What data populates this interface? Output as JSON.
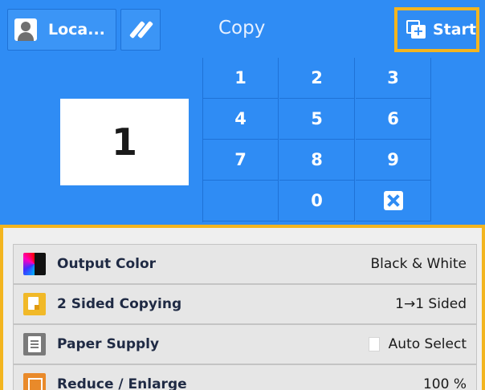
{
  "header": {
    "user_label": "Loca...",
    "title": "Copy",
    "start_label": "Start",
    "accent_color": "#2f8cf4",
    "highlight_color": "#f3b51f"
  },
  "quantity": {
    "value": "1"
  },
  "keypad": {
    "keys": [
      "1",
      "2",
      "3",
      "4",
      "5",
      "6",
      "7",
      "8",
      "9",
      "0"
    ],
    "clear_icon": "clear-icon"
  },
  "features": [
    {
      "name": "Output Color",
      "value": "Black & White",
      "icon": "color-mode-icon"
    },
    {
      "name": "2 Sided Copying",
      "value": "1→1 Sided",
      "icon": "duplex-icon"
    },
    {
      "name": "Paper Supply",
      "value": "Auto Select",
      "icon": "paper-tray-icon"
    },
    {
      "name": "Reduce / Enlarge",
      "value": "100 %",
      "icon": "reduce-enlarge-icon"
    }
  ]
}
